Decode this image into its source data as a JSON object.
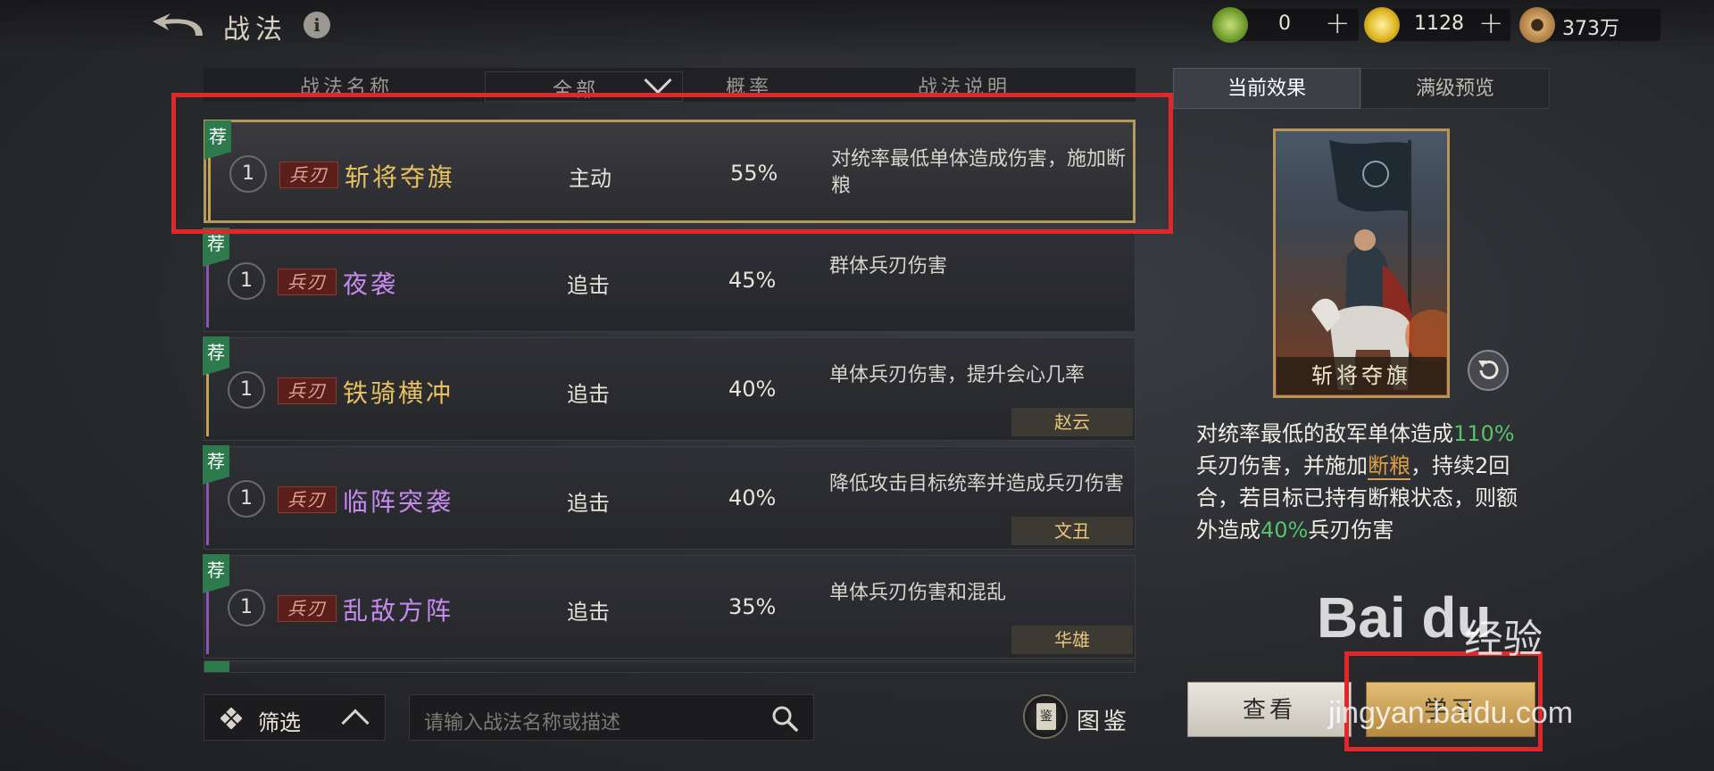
{
  "header": {
    "title": "战法",
    "info_icon": "i",
    "resources": [
      {
        "icon": "jade-coin-icon",
        "value": "0",
        "color": "#7fae3a"
      },
      {
        "icon": "gold-coin-icon",
        "value": "1128",
        "color": "#d8b22a"
      },
      {
        "icon": "copper-coin-icon",
        "value": "373万",
        "color": "#b07a3a"
      }
    ],
    "plus": "+"
  },
  "table": {
    "headers": {
      "name": "战法名称",
      "filter": "全部",
      "prob": "概率",
      "desc": "战法说明"
    },
    "rows": [
      {
        "rec": "荐",
        "level": "1",
        "weapon": "兵刃",
        "name": "斩将夺旗",
        "name_color": "#e8c060",
        "type": "主动",
        "prob": "55%",
        "desc": "对统率最低单体造成伤害，施加断粮",
        "hero": ""
      },
      {
        "rec": "荐",
        "level": "1",
        "weapon": "兵刃",
        "name": "夜袭",
        "name_color": "#c78bf0",
        "type": "追击",
        "prob": "45%",
        "desc": "群体兵刃伤害",
        "hero": ""
      },
      {
        "rec": "荐",
        "level": "1",
        "weapon": "兵刃",
        "name": "铁骑横冲",
        "name_color": "#e8c060",
        "type": "追击",
        "prob": "40%",
        "desc": "单体兵刃伤害，提升会心几率",
        "hero": "赵云"
      },
      {
        "rec": "荐",
        "level": "1",
        "weapon": "兵刃",
        "name": "临阵突袭",
        "name_color": "#c78bf0",
        "type": "追击",
        "prob": "40%",
        "desc": "降低攻击目标统率并造成兵刃伤害",
        "hero": "文丑"
      },
      {
        "rec": "荐",
        "level": "1",
        "weapon": "兵刃",
        "name": "乱敌方阵",
        "name_color": "#c78bf0",
        "type": "追击",
        "prob": "35%",
        "desc": "单体兵刃伤害和混乱",
        "hero": "华雄"
      }
    ]
  },
  "bottom": {
    "filter_label": "筛选",
    "search_placeholder": "请输入战法名称或描述",
    "codex_icon_text": "鉴",
    "codex_label": "图鉴"
  },
  "panel": {
    "tabs": [
      "当前效果",
      "满级预览"
    ],
    "card_name": "斩将夺旗",
    "effect": {
      "p1": "对统率最低的敌军单体造成",
      "v1": "110%",
      "p2": "兵刃伤害，并施加",
      "kw": "断粮",
      "p3": "，持续2回合，若目标已持有断粮状态，则额外造成",
      "v2": "40%",
      "p4": "兵刃伤害"
    },
    "view_button": "查看",
    "learn_button": "学习"
  },
  "watermark": {
    "logo": "Bai du",
    "jingyan": "经验",
    "url": "jingyan.baidu.com"
  }
}
